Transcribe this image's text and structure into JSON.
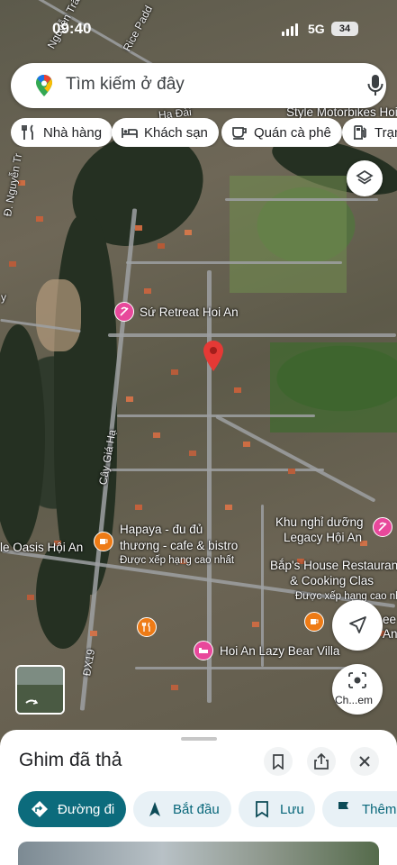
{
  "status": {
    "time": "09:40",
    "network": "5G",
    "battery": "34"
  },
  "search": {
    "placeholder": "Tìm kiếm ở đây"
  },
  "chips": [
    {
      "label": "Nhà hàng",
      "icon": "restaurant-icon"
    },
    {
      "label": "Khách sạn",
      "icon": "bed-icon"
    },
    {
      "label": "Quán cà phê",
      "icon": "coffee-icon"
    },
    {
      "label": "Trạm",
      "icon": "gas-station-icon"
    }
  ],
  "map_labels": {
    "street_nguyen_trai_top": "Nguyễn Trãi",
    "street_rice_paddy": "Rice Padd",
    "street_ha_dai": "Hạ Đài",
    "street_nguyen_tr_left": "Đ. Nguyễn Tr",
    "style_motorbikes": "Style Motorbikes Hoi",
    "su_retreat": "Sứ Retreat Hoi An",
    "cay_gia_ha": "Cây Giá Hạ",
    "hapaya_1": "Hapaya - đu đủ",
    "hapaya_2": "thương - cafe & bistro",
    "hapaya_rated": "Được xếp hạng cao nhất",
    "oasis": "le Oasis Hội An",
    "khu_nghi_duong_1": "Khu nghỉ dưỡng",
    "khu_nghi_duong_2": "Legacy Hội An",
    "baps_1": "Bắp's House Restaurant",
    "baps_2": "& Cooking Clas",
    "baps_rated": "Được xếp hạng cao nhấ",
    "partial_ee": "ee",
    "partial_an": "An",
    "lazy_bear": "Hoi An Lazy Bear Villa",
    "dx19": "ĐX19",
    "edge_y": "y"
  },
  "camera_caption": "Ch...em",
  "sheet": {
    "title": "Ghim đã thả",
    "actions": [
      {
        "label": "Đường đi",
        "icon": "directions-icon"
      },
      {
        "label": "Bắt đầu",
        "icon": "navigation-arrow-icon"
      },
      {
        "label": "Lưu",
        "icon": "bookmark-icon"
      },
      {
        "label": "Thêm",
        "icon": "flag-icon"
      }
    ]
  },
  "colors": {
    "accent": "#0c6b7c",
    "accent_light": "#e8f1f6",
    "pin_red": "#e53935",
    "poi_pink": "#e8489b",
    "poi_orange": "#ee7b16"
  }
}
